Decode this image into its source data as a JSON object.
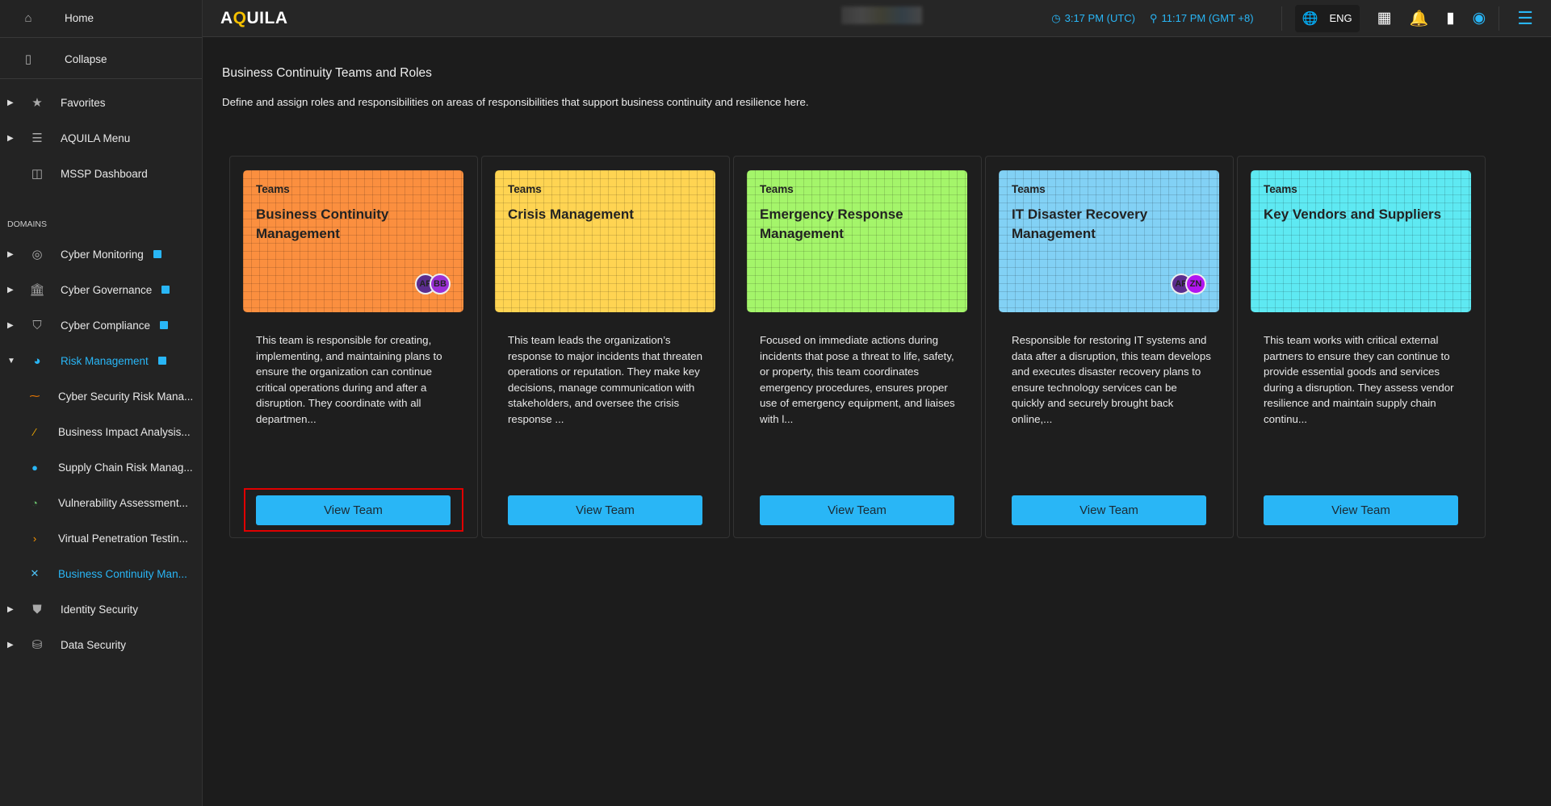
{
  "sidebar": {
    "home": "Home",
    "collapse": "Collapse",
    "items": [
      {
        "label": "Favorites",
        "icon": "star-icon"
      },
      {
        "label": "AQUILA Menu",
        "icon": "menu-icon"
      },
      {
        "label": "MSSP Dashboard",
        "icon": "dashboard-icon"
      }
    ],
    "domains_label": "DOMAINS",
    "domains": [
      {
        "label": "Cyber Monitoring"
      },
      {
        "label": "Cyber Governance"
      },
      {
        "label": "Cyber Compliance"
      },
      {
        "label": "Risk Management",
        "active": true
      }
    ],
    "risk_sub": [
      "Cyber Security Risk Mana...",
      "Business Impact Analysis...",
      "Supply Chain Risk Manag...",
      "Vulnerability Assessment...",
      "Virtual Penetration Testin...",
      "Business Continuity Man..."
    ],
    "bottom": [
      {
        "label": "Identity Security"
      },
      {
        "label": "Data Security"
      }
    ]
  },
  "header": {
    "logo": "AQUILA",
    "utc_time": "3:17 PM (UTC)",
    "local_time": "11:17 PM (GMT +8)",
    "language": "ENG"
  },
  "page": {
    "title": "Business Continuity Teams and Roles",
    "description": "Define and assign roles and responsibilities on areas of responsibilities that support business continuity and resilience here."
  },
  "colors": {
    "accent": "#29b6f6",
    "highlight": "#e00000"
  },
  "cards": [
    {
      "label": "Teams",
      "title": "Business Continuity Management",
      "color": "#fb8f3f",
      "avatars": [
        {
          "initials": "AP",
          "color": "#5b2d8e"
        },
        {
          "initials": "BB",
          "color": "#9b2fd6"
        }
      ],
      "description": "This team is responsible for creating, implementing, and maintaining plans to ensure the organization can continue critical operations during and after a disruption. They coordinate with all departmen...",
      "button": "View Team"
    },
    {
      "label": "Teams",
      "title": "Crisis Management",
      "color": "#ffd452",
      "avatars": [],
      "description": "This team leads the organization’s response to major incidents that threaten operations or reputation. They make key decisions, manage communication with stakeholders, and oversee the crisis response ...",
      "button": "View Team"
    },
    {
      "label": "Teams",
      "title": "Emergency Response Management",
      "color": "#a4f56a",
      "avatars": [],
      "description": "Focused on immediate actions during incidents that pose a threat to life, safety, or property, this team coordinates emergency procedures, ensures proper use of emergency equipment, and liaises with l...",
      "button": "View Team"
    },
    {
      "label": "Teams",
      "title": "IT Disaster Recovery Management",
      "color": "#82d1f5",
      "avatars": [
        {
          "initials": "AP",
          "color": "#5b2d8e"
        },
        {
          "initials": "ZN",
          "color": "#b215f0"
        }
      ],
      "description": "Responsible for restoring IT systems and data after a disruption, this team develops and executes disaster recovery plans to ensure technology services can be quickly and securely brought back online,...",
      "button": "View Team"
    },
    {
      "label": "Teams",
      "title": "Key Vendors and Suppliers",
      "color": "#5ee9f2",
      "avatars": [],
      "description": "This team works with critical external partners to ensure they can continue to provide essential goods and services during a disruption. They assess vendor resilience and maintain supply chain continu...",
      "button": "View Team"
    }
  ]
}
